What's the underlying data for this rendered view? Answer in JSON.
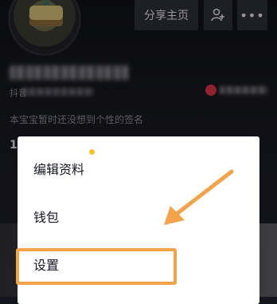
{
  "header": {
    "share_label": "分享主页",
    "add_friend_icon": "person-add-icon",
    "more_icon": "more-icon",
    "more_label": "•••"
  },
  "profile": {
    "douyin_prefix": "抖音",
    "bio": "本宝宝暂时还没想到个性的签名",
    "stat_digit": "1"
  },
  "menu": {
    "items": [
      {
        "label": "编辑资料"
      },
      {
        "label": "钱包"
      },
      {
        "label": "设置"
      }
    ],
    "notification_dot_color": "#fac32b"
  },
  "annotation": {
    "highlight_color": "#f3a34a",
    "arrow_color": "#f3a34a"
  }
}
